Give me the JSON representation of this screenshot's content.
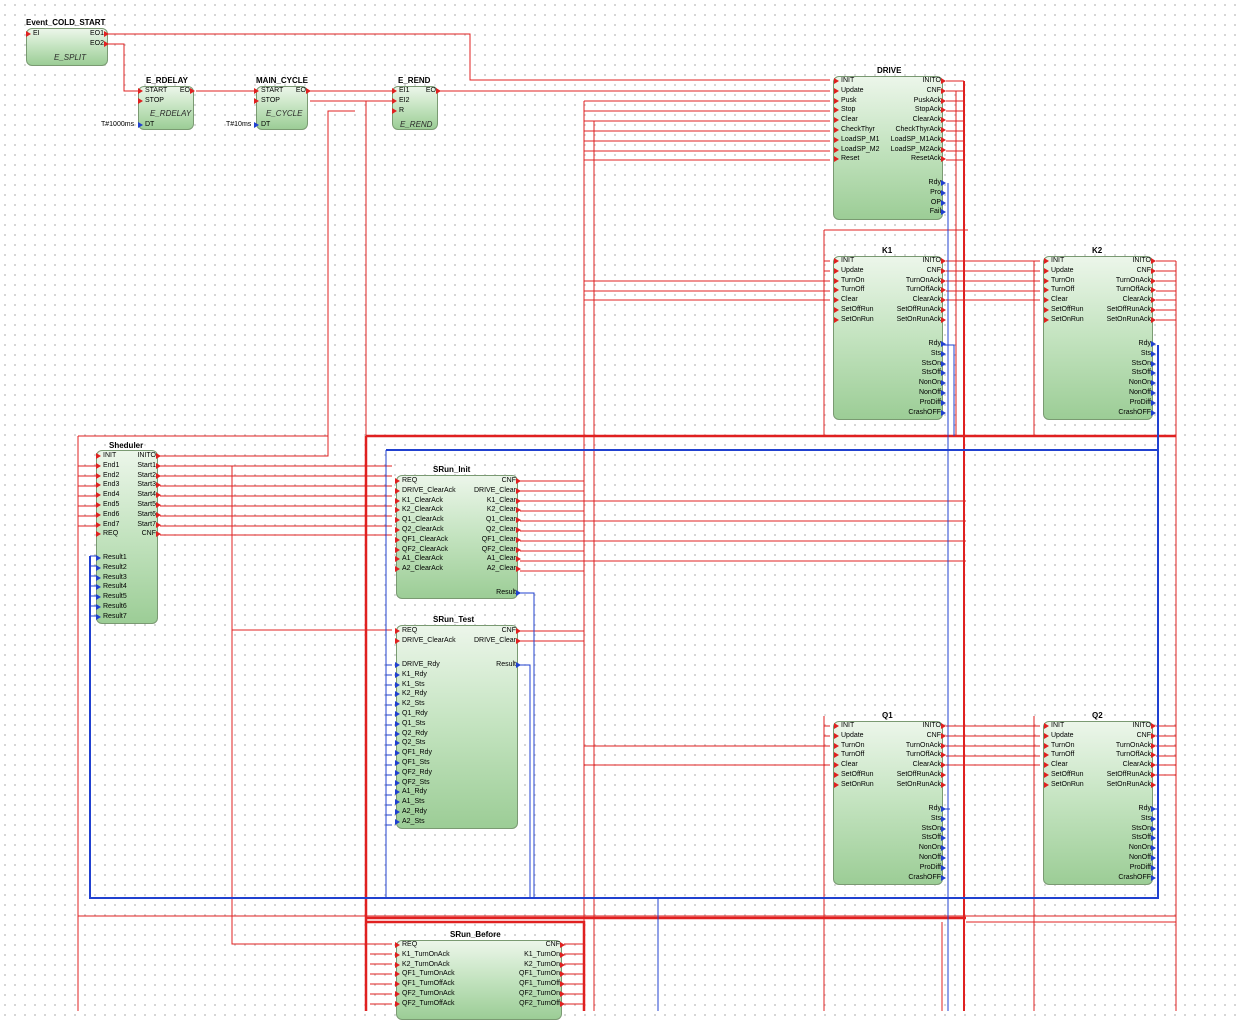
{
  "diagram": {
    "title": "",
    "colors": {
      "event": "#e02020",
      "data": "#2040d0",
      "block_top": "#ecf6ea",
      "block_bottom": "#9ccd96",
      "grid": "#c8c8c8"
    },
    "blocks": [
      {
        "id": "event_cold_start",
        "name": "Event_COLD_START",
        "type": "E_SPLIT",
        "inputs": [
          "EI"
        ],
        "outputs": [
          "EO1",
          "EO2"
        ],
        "params": []
      },
      {
        "id": "e_rdelay",
        "name": "E_RDELAY",
        "type": "E_RDELAY",
        "inputs": [
          "START",
          "STOP",
          "DT"
        ],
        "outputs": [
          "EO"
        ],
        "params": [
          "T#1000ms"
        ]
      },
      {
        "id": "main_cycle",
        "name": "MAIN_CYCLE",
        "type": "E_CYCLE",
        "inputs": [
          "START",
          "STOP",
          "DT"
        ],
        "outputs": [
          "EO"
        ],
        "params": [
          "T#10ms"
        ]
      },
      {
        "id": "e_rend",
        "name": "E_REND",
        "type": "E_REND",
        "inputs": [
          "EI1",
          "EI2",
          "R"
        ],
        "outputs": [
          "EO"
        ],
        "params": []
      },
      {
        "id": "drive",
        "name": "DRIVE",
        "type": "",
        "inputs": [
          "INIT",
          "Update",
          "Pusk",
          "Stop",
          "Clear",
          "CheckThyr",
          "LoadSP_M1",
          "LoadSP_M2",
          "Reset"
        ],
        "outputs": [
          "INITO",
          "CNF",
          "PuskAck",
          "StopAck",
          "ClearAck",
          "CheckThyrAck",
          "LoadSP_M1Ack",
          "LoadSP_M2Ack",
          "ResetAck"
        ],
        "data_outputs": [
          "Rdy",
          "Pro",
          "OP",
          "Fail"
        ]
      },
      {
        "id": "k1",
        "name": "K1",
        "type": "",
        "inputs": [
          "INIT",
          "Update",
          "TurnOn",
          "TurnOff",
          "Clear",
          "SetOffRun",
          "SetOnRun"
        ],
        "outputs": [
          "INITO",
          "CNF",
          "TurnOnAck",
          "TurnOffAck",
          "ClearAck",
          "SetOffRunAck",
          "SetOnRunAck"
        ],
        "data_outputs": [
          "Rdy",
          "Sts",
          "StsOn",
          "StsOff",
          "NonOn",
          "NonOff",
          "ProDiff",
          "CrashOFF"
        ]
      },
      {
        "id": "k2",
        "name": "K2",
        "type": "",
        "inputs": [
          "INIT",
          "Update",
          "TurnOn",
          "TurnOff",
          "Clear",
          "SetOffRun",
          "SetOnRun"
        ],
        "outputs": [
          "INITO",
          "CNF",
          "TurnOnAck",
          "TurnOffAck",
          "ClearAck",
          "SetOffRunAck",
          "SetOnRunAck"
        ],
        "data_outputs": [
          "Rdy",
          "Sts",
          "StsOn",
          "StsOff",
          "NonOn",
          "NonOff",
          "ProDiff",
          "CrashOFF"
        ]
      },
      {
        "id": "q1",
        "name": "Q1",
        "type": "",
        "inputs": [
          "INIT",
          "Update",
          "TurnOn",
          "TurnOff",
          "Clear",
          "SetOffRun",
          "SetOnRun"
        ],
        "outputs": [
          "INITO",
          "CNF",
          "TurnOnAck",
          "TurnOffAck",
          "ClearAck",
          "SetOffRunAck",
          "SetOnRunAck"
        ],
        "data_outputs": [
          "Rdy",
          "Sts",
          "StsOn",
          "StsOff",
          "NonOn",
          "NonOff",
          "ProDiff",
          "CrashOFF"
        ]
      },
      {
        "id": "q2",
        "name": "Q2",
        "type": "",
        "inputs": [
          "INIT",
          "Update",
          "TurnOn",
          "TurnOff",
          "Clear",
          "SetOffRun",
          "SetOnRun"
        ],
        "outputs": [
          "INITO",
          "CNF",
          "TurnOnAck",
          "TurnOffAck",
          "ClearAck",
          "SetOffRunAck",
          "SetOnRunAck"
        ],
        "data_outputs": [
          "Rdy",
          "Sts",
          "StsOn",
          "StsOff",
          "NonOn",
          "NonOff",
          "ProDiff",
          "CrashOFF"
        ]
      },
      {
        "id": "sheduler",
        "name": "Sheduler",
        "type": "",
        "inputs": [
          "INIT",
          "End1",
          "End2",
          "End3",
          "End4",
          "End5",
          "End6",
          "End7",
          "REQ"
        ],
        "outputs": [
          "INITO",
          "Start1",
          "Start2",
          "Start3",
          "Start4",
          "Start5",
          "Start6",
          "Start7",
          "CNF"
        ],
        "data_inputs": [
          "Result1",
          "Result2",
          "Result3",
          "Result4",
          "Result5",
          "Result6",
          "Result7"
        ]
      },
      {
        "id": "srun_init",
        "name": "SRun_Init",
        "type": "",
        "inputs": [
          "REQ",
          "DRIVE_ClearAck",
          "K1_ClearAck",
          "K2_ClearAck",
          "Q1_ClearAck",
          "Q2_ClearAck",
          "QF1_ClearAck",
          "QF2_ClearAck",
          "A1_ClearAck",
          "A2_ClearAck"
        ],
        "outputs": [
          "CNF",
          "DRIVE_Clear",
          "K1_Clear",
          "K2_Clear",
          "Q1_Clear",
          "Q2_Clear",
          "QF1_Clear",
          "QF2_Clear",
          "A1_Clear",
          "A2_Clear"
        ],
        "data_outputs": [
          "Result"
        ]
      },
      {
        "id": "srun_test",
        "name": "SRun_Test",
        "type": "",
        "inputs": [
          "REQ",
          "DRIVE_ClearAck"
        ],
        "outputs": [
          "CNF",
          "DRIVE_Clear"
        ],
        "data_inputs": [
          "DRIVE_Rdy",
          "K1_Rdy",
          "K1_Sts",
          "K2_Rdy",
          "K2_Sts",
          "Q1_Rdy",
          "Q1_Sts",
          "Q2_Rdy",
          "Q2_Sts",
          "QF1_Rdy",
          "QF1_Sts",
          "QF2_Rdy",
          "QF2_Sts",
          "A1_Rdy",
          "A1_Sts",
          "A2_Rdy",
          "A2_Sts"
        ],
        "data_outputs": [
          "Result"
        ]
      },
      {
        "id": "srun_before",
        "name": "SRun_Before",
        "type": "",
        "inputs": [
          "REQ",
          "K1_TurnOnAck",
          "K2_TurnOnAck",
          "QF1_TurnOnAck",
          "QF1_TurnOffAck",
          "QF2_TurnOnAck",
          "QF2_TurnOffAck"
        ],
        "outputs": [
          "CNF",
          "K1_TurnOn",
          "K2_TurnOn",
          "QF1_TurnOn",
          "QF1_TurnOff",
          "QF2_TurnOn",
          "QF2_TurnOff"
        ]
      }
    ]
  }
}
